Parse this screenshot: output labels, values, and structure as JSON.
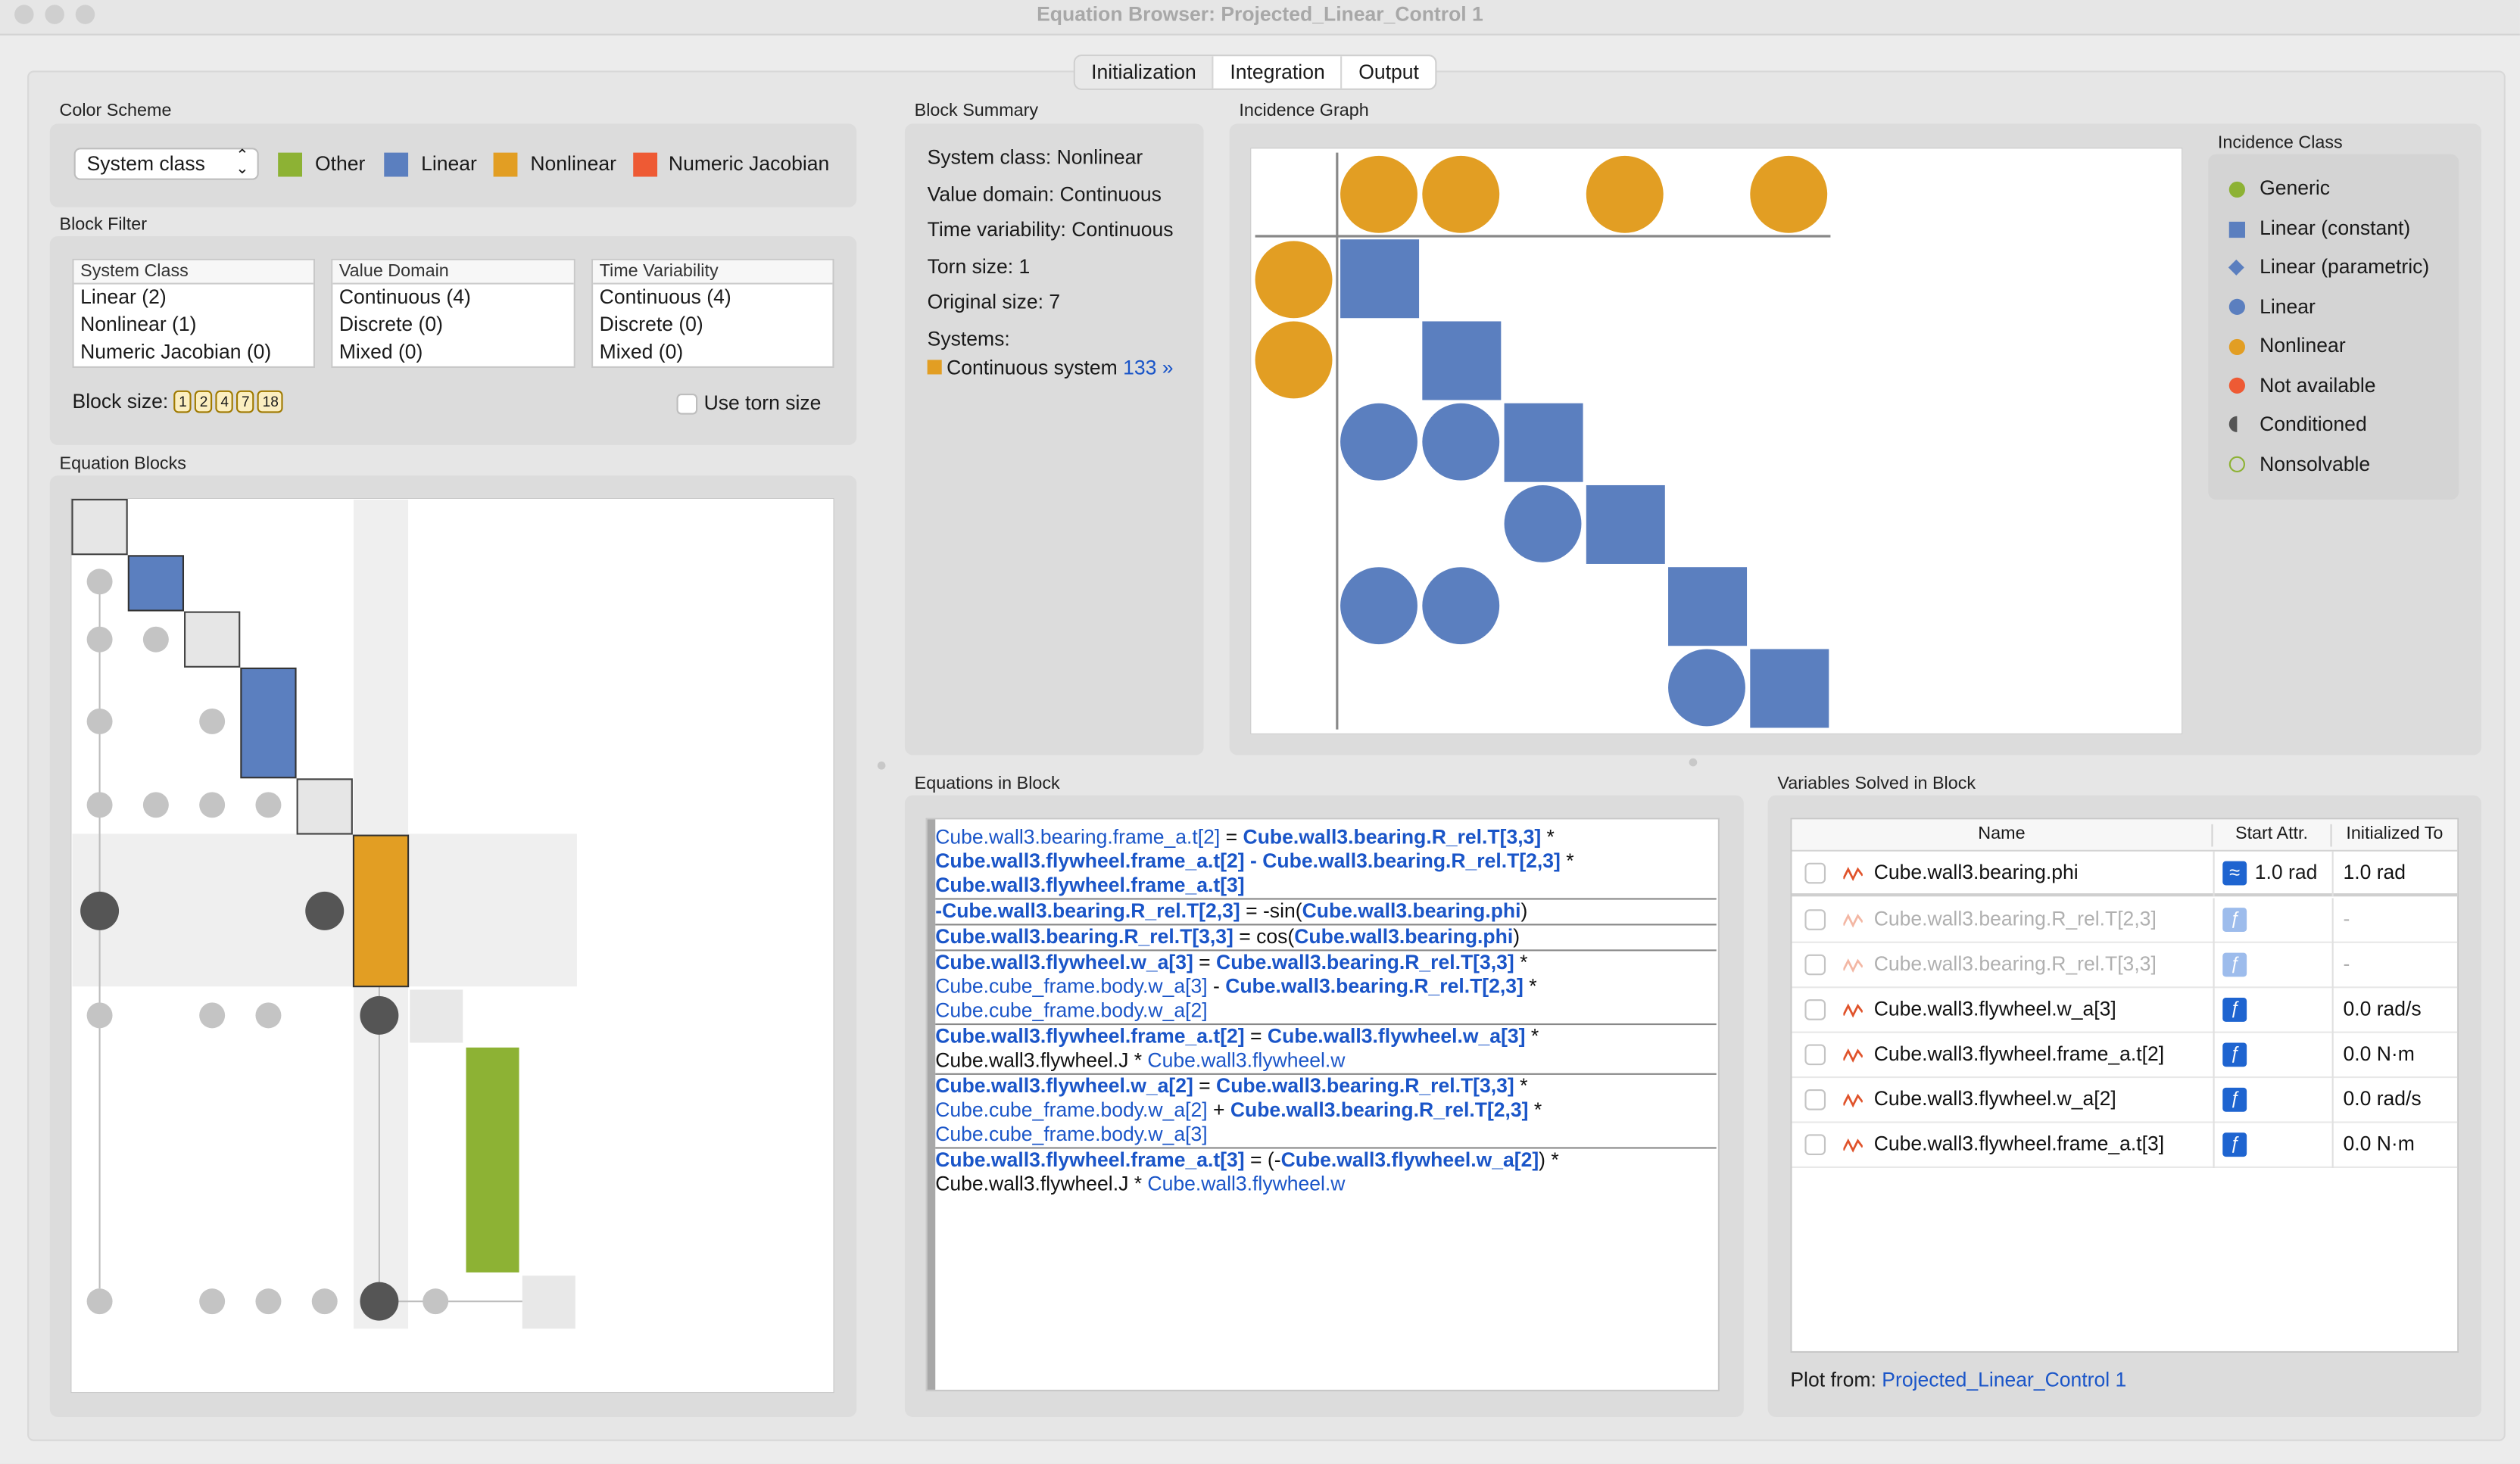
{
  "window": {
    "title": "Equation Browser: Projected_Linear_Control 1"
  },
  "tabs": [
    "Initialization",
    "Integration",
    "Output"
  ],
  "color_scheme": {
    "label": "Color Scheme",
    "select_value": "System class",
    "legend": [
      {
        "label": "Other",
        "color": "#8db234"
      },
      {
        "label": "Linear",
        "color": "#5b7fbf"
      },
      {
        "label": "Nonlinear",
        "color": "#e29e23"
      },
      {
        "label": "Numeric Jacobian",
        "color": "#ee5a34"
      }
    ]
  },
  "block_filter": {
    "label": "Block Filter",
    "lists": [
      {
        "header": "System Class",
        "items": [
          "Linear (2)",
          "Nonlinear (1)",
          "Numeric Jacobian (0)"
        ]
      },
      {
        "header": "Value Domain",
        "items": [
          "Continuous (4)",
          "Discrete (0)",
          "Mixed (0)"
        ]
      },
      {
        "header": "Time Variability",
        "items": [
          "Continuous (4)",
          "Discrete (0)",
          "Mixed (0)"
        ]
      }
    ],
    "block_size_label": "Block size:",
    "block_sizes": [
      "1",
      "2",
      "4",
      "7",
      "18"
    ],
    "use_torn_size": "Use torn size"
  },
  "equation_blocks": {
    "label": "Equation Blocks"
  },
  "block_summary": {
    "label": "Block Summary",
    "lines": [
      "System class: Nonlinear",
      "Value domain: Continuous",
      "Time variability: Continuous",
      "Torn size: 1",
      "Original size: 7"
    ],
    "systems_label": "Systems:",
    "system_name": "Continuous system",
    "system_link": "133 »"
  },
  "incidence_graph": {
    "label": "Incidence Graph"
  },
  "incidence_class": {
    "label": "Incidence Class",
    "items": [
      {
        "label": "Generic",
        "icon": "green-circle-icon"
      },
      {
        "label": "Linear (constant)",
        "icon": "blue-square-icon"
      },
      {
        "label": "Linear (parametric)",
        "icon": "blue-diamond-icon"
      },
      {
        "label": "Linear",
        "icon": "blue-circle-icon"
      },
      {
        "label": "Nonlinear",
        "icon": "orange-circle-icon"
      },
      {
        "label": "Not available",
        "icon": "red-circle-icon"
      },
      {
        "label": "Conditioned",
        "icon": "half-circle-icon"
      },
      {
        "label": "Nonsolvable",
        "icon": "hollow-circle-icon"
      }
    ]
  },
  "equations": {
    "label": "Equations in Block",
    "blocks": [
      [
        [
          [
            "Cube.wall3.bearing.frame_a.t[2]",
            "l"
          ],
          [
            " = ",
            "k"
          ],
          [
            "Cube.wall3.bearing.R_rel.T[3,3]",
            "b"
          ],
          [
            " *",
            "k"
          ]
        ],
        [
          [
            "Cube.wall3.flywheel.frame_a.t[2]",
            "b"
          ],
          [
            " - ",
            "bk"
          ],
          [
            "Cube.wall3.bearing.R_rel.T[2,3]",
            "b"
          ],
          [
            " *",
            "k"
          ]
        ],
        [
          [
            "Cube.wall3.flywheel.frame_a.t[3]",
            "b"
          ]
        ]
      ],
      [
        [
          [
            "-Cube.wall3.bearing.R_rel.T[2,3]",
            "b"
          ],
          [
            " = -sin(",
            "k"
          ],
          [
            "Cube.wall3.bearing.phi",
            "b"
          ],
          [
            ")",
            "k"
          ]
        ]
      ],
      [
        [
          [
            "Cube.wall3.bearing.R_rel.T[3,3]",
            "b"
          ],
          [
            " = cos(",
            "k"
          ],
          [
            "Cube.wall3.bearing.phi",
            "b"
          ],
          [
            ")",
            "k"
          ]
        ]
      ],
      [
        [
          [
            "Cube.wall3.flywheel.w_a[3]",
            "b"
          ],
          [
            " = ",
            "k"
          ],
          [
            "Cube.wall3.bearing.R_rel.T[3,3]",
            "b"
          ],
          [
            " *",
            "k"
          ]
        ],
        [
          [
            "Cube.cube_frame.body.w_a[3]",
            "l"
          ],
          [
            " - ",
            "k"
          ],
          [
            "Cube.wall3.bearing.R_rel.T[2,3]",
            "b"
          ],
          [
            " *",
            "k"
          ]
        ],
        [
          [
            "Cube.cube_frame.body.w_a[2]",
            "l"
          ]
        ]
      ],
      [
        [
          [
            "Cube.wall3.flywheel.frame_a.t[2]",
            "b"
          ],
          [
            " = ",
            "k"
          ],
          [
            "Cube.wall3.flywheel.w_a[3]",
            "b"
          ],
          [
            " *",
            "k"
          ]
        ],
        [
          [
            "Cube.wall3.flywheel.J",
            "k"
          ],
          [
            " * ",
            "k"
          ],
          [
            "Cube.wall3.flywheel.w",
            "l"
          ]
        ]
      ],
      [
        [
          [
            "Cube.wall3.flywheel.w_a[2]",
            "b"
          ],
          [
            " = ",
            "k"
          ],
          [
            "Cube.wall3.bearing.R_rel.T[3,3]",
            "b"
          ],
          [
            " *",
            "k"
          ]
        ],
        [
          [
            "Cube.cube_frame.body.w_a[2]",
            "l"
          ],
          [
            " + ",
            "k"
          ],
          [
            "Cube.wall3.bearing.R_rel.T[2,3]",
            "b"
          ],
          [
            " *",
            "k"
          ]
        ],
        [
          [
            "Cube.cube_frame.body.w_a[3]",
            "l"
          ]
        ]
      ],
      [
        [
          [
            "Cube.wall3.flywheel.frame_a.t[3]",
            "b"
          ],
          [
            " = (-",
            "k"
          ],
          [
            "Cube.wall3.flywheel.w_a[2]",
            "b"
          ],
          [
            ") *",
            "k"
          ]
        ],
        [
          [
            "Cube.wall3.flywheel.J",
            "k"
          ],
          [
            " * ",
            "k"
          ],
          [
            "Cube.wall3.flywheel.w",
            "l"
          ]
        ]
      ]
    ]
  },
  "variables": {
    "label": "Variables Solved in Block",
    "columns": [
      "Name",
      "Start Attr.",
      "Initialized To"
    ],
    "rows": [
      {
        "name": "Cube.wall3.bearing.phi",
        "start": "1.0 rad",
        "init": "1.0 rad",
        "dim": false,
        "approx": true
      },
      {
        "name": "Cube.wall3.bearing.R_rel.T[2,3]",
        "start": "",
        "init": "-",
        "dim": true,
        "approx": false
      },
      {
        "name": "Cube.wall3.bearing.R_rel.T[3,3]",
        "start": "",
        "init": "-",
        "dim": true,
        "approx": false
      },
      {
        "name": "Cube.wall3.flywheel.w_a[3]",
        "start": "",
        "init": "0.0 rad/s",
        "dim": false,
        "approx": false
      },
      {
        "name": "Cube.wall3.flywheel.frame_a.t[2]",
        "start": "",
        "init": "0.0 N·m",
        "dim": false,
        "approx": false
      },
      {
        "name": "Cube.wall3.flywheel.w_a[2]",
        "start": "",
        "init": "0.0 rad/s",
        "dim": false,
        "approx": false
      },
      {
        "name": "Cube.wall3.flywheel.frame_a.t[3]",
        "start": "",
        "init": "0.0 N·m",
        "dim": false,
        "approx": false
      }
    ],
    "plot_from_label": "Plot from:",
    "plot_from_link": "Projected_Linear_Control 1"
  }
}
